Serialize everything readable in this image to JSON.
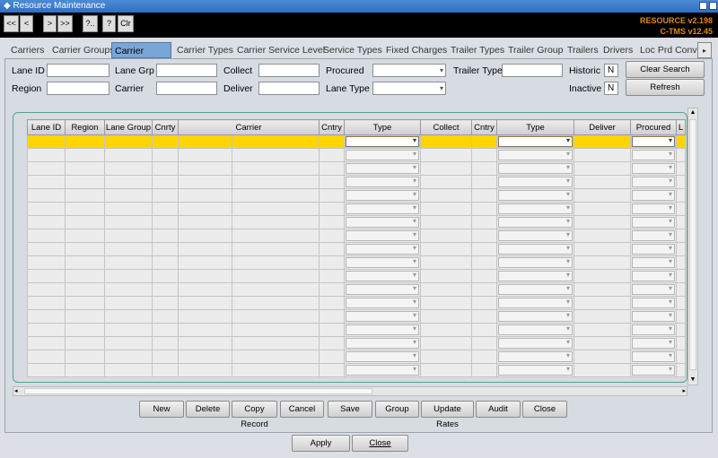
{
  "window": {
    "title": "Resource Maintenance"
  },
  "toolbar": {
    "buttons": [
      "<<",
      "<",
      ">",
      ">>",
      "?..",
      "?",
      "Clr"
    ],
    "version_line1": "RESOURCE v2.198",
    "version_line2": "C-TMS v12.45"
  },
  "tabs": [
    "Carriers",
    "Carrier Groups",
    "Carrier Lanes",
    "Carrier Types",
    "Carrier Service Level",
    "Service Types",
    "Fixed Charges",
    "Trailer Types",
    "Trailer Group",
    "Trailers",
    "Drivers",
    "Loc Prd Conv"
  ],
  "active_tab": "Carrier Lanes",
  "search": {
    "lane_id": {
      "label": "Lane ID",
      "value": ""
    },
    "lane_grp": {
      "label": "Lane Grp",
      "value": ""
    },
    "collect": {
      "label": "Collect",
      "value": ""
    },
    "procured": {
      "label": "Procured",
      "value": ""
    },
    "trailer_type": {
      "label": "Trailer Type",
      "value": ""
    },
    "historic": {
      "label": "Historic",
      "value": "N"
    },
    "region": {
      "label": "Region",
      "value": ""
    },
    "carrier": {
      "label": "Carrier",
      "value": ""
    },
    "deliver": {
      "label": "Deliver",
      "value": ""
    },
    "lane_type": {
      "label": "Lane Type",
      "value": ""
    },
    "inactive": {
      "label": "Inactive",
      "value": "N"
    },
    "clear_label": "Clear Search Criteria",
    "refresh_label": "Refresh"
  },
  "grid": {
    "columns": [
      "Lane ID",
      "Region",
      "Lane Group",
      "Cnrty",
      "Carrier",
      "Cntry",
      "Type",
      "Collect",
      "Cntry",
      "Type",
      "Deliver",
      "Procured",
      "L"
    ],
    "row_count": 18
  },
  "actions": [
    "New",
    "Delete",
    "Copy Record",
    "Cancel",
    "Save",
    "Group",
    "Update Rates",
    "Audit",
    "Close"
  ],
  "footer": {
    "apply": "Apply",
    "close": "Close"
  },
  "colors": {
    "title_bar": "#2f6fc0",
    "selected_row": "#ffd400",
    "version_text": "#e08a1a",
    "active_tab": "#7aa6d6"
  }
}
